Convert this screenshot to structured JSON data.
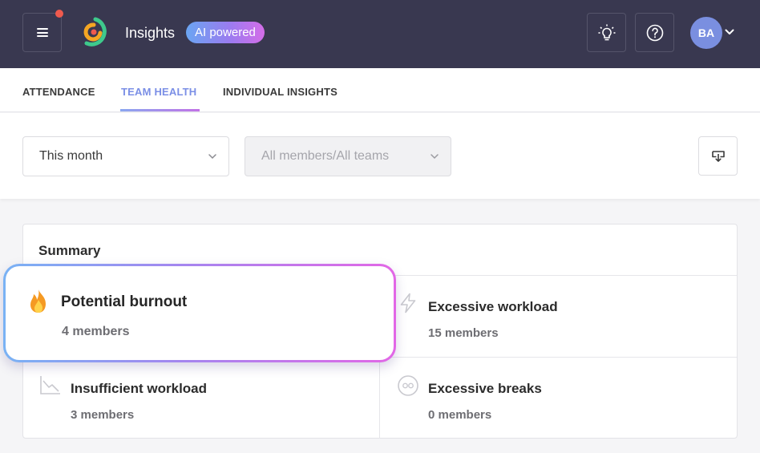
{
  "header": {
    "app_title": "Insights",
    "ai_badge": "AI powered",
    "avatar_initials": "BA",
    "colors": {
      "bar_bg": "#393850",
      "notification": "#ef5a4e",
      "avatar": "#7a8fe0"
    }
  },
  "tabs": [
    {
      "label": "ATTENDANCE",
      "active": false
    },
    {
      "label": "TEAM HEALTH",
      "active": true
    },
    {
      "label": "INDIVIDUAL INSIGHTS",
      "active": false
    }
  ],
  "filters": {
    "period": {
      "value": "This month"
    },
    "members": {
      "value": "All members/All teams",
      "disabled": true
    }
  },
  "summary": {
    "title": "Summary",
    "metrics": [
      {
        "title": "Potential burnout",
        "count": "4 members",
        "icon": "fire-icon",
        "highlighted": true
      },
      {
        "title": "Excessive workload",
        "count": "15 members",
        "icon": "lightning-icon"
      },
      {
        "title": "Insufficient workload",
        "count": "3 members",
        "icon": "trend-down-icon"
      },
      {
        "title": "Excessive breaks",
        "count": "0 members",
        "icon": "pause-icon"
      }
    ]
  }
}
